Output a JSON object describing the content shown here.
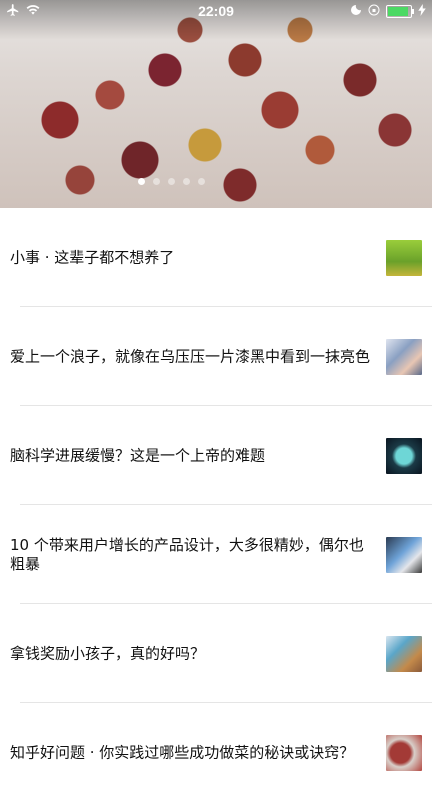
{
  "status_bar": {
    "time": "22:09",
    "airplane_icon": "airplane-icon",
    "wifi_icon": "wifi-icon",
    "battery_level": 0.9
  },
  "banner": {
    "image": "sichuan-pepper-photo",
    "page_dots": 5,
    "active_dot": 0
  },
  "stories": [
    {
      "title": "小事 · 这辈子都不想养了",
      "thumb": "ducklings-on-grass"
    },
    {
      "title": "爱上一个浪子，就像在乌压压一片漆黑中看到一抹亮色",
      "thumb": "couple-photo"
    },
    {
      "title": "脑科学进展缓慢？这是一个上帝的难题",
      "thumb": "brain-illustration"
    },
    {
      "title": "10 个带来用户增长的产品设计，大多很精妙，偶尔也粗暴",
      "thumb": "phone-in-hand"
    },
    {
      "title": "拿钱奖励小孩子，真的好吗？",
      "thumb": "coins-and-hands"
    },
    {
      "title": "知乎好问题 · 你实践过哪些成功做菜的秘诀或诀窍？",
      "thumb": "peppercorns"
    }
  ]
}
